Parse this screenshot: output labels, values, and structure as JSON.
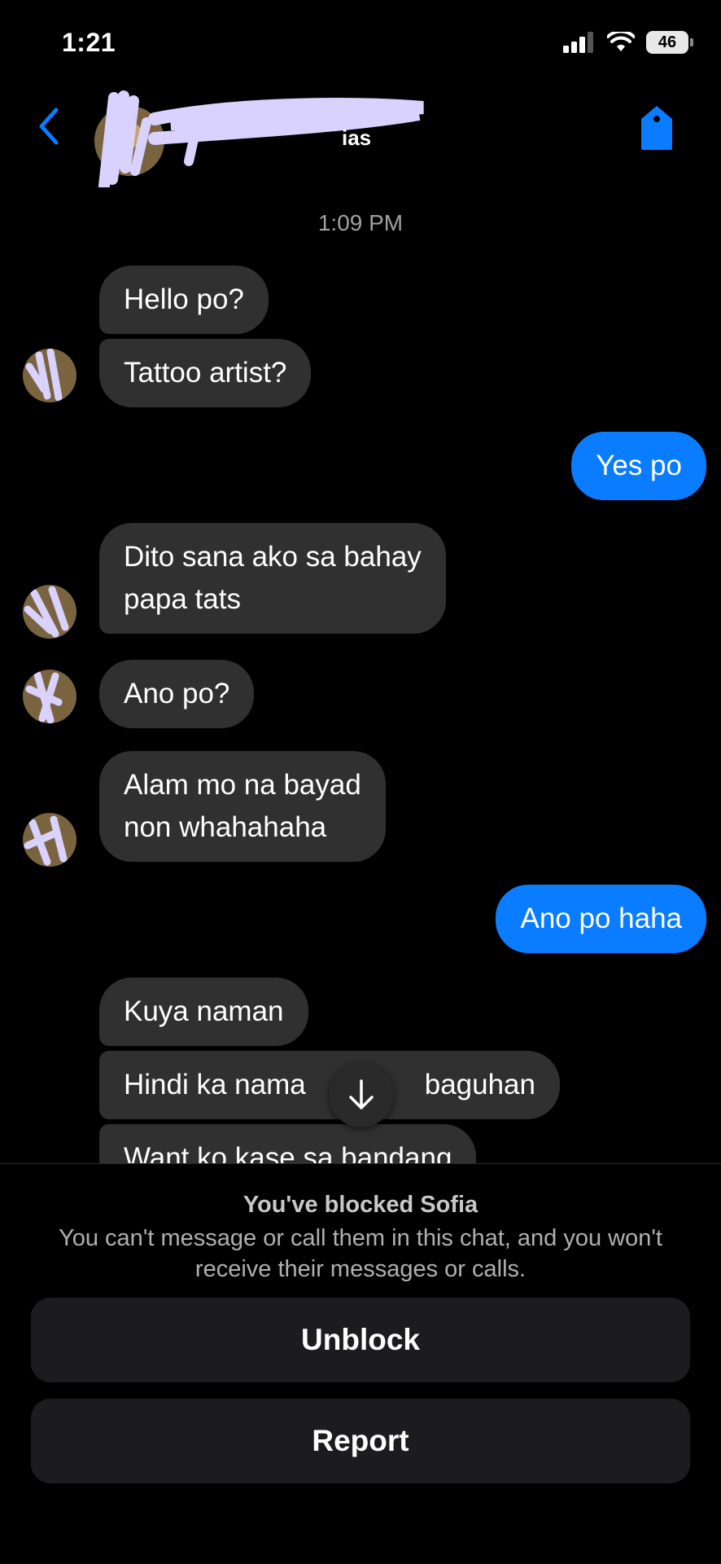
{
  "status_bar": {
    "time": "1:21",
    "battery": "46"
  },
  "header": {
    "contact_name": "redacted",
    "accent": "#0a7cff"
  },
  "chat": {
    "timestamp": "1:09 PM",
    "messages": [
      {
        "side": "in",
        "text": "Hello po?"
      },
      {
        "side": "in",
        "text": "Tattoo artist?"
      },
      {
        "side": "out",
        "text": "Yes po"
      },
      {
        "side": "in",
        "lines": [
          "Dito sana ako sa bahay",
          "papa tats"
        ]
      },
      {
        "side": "in",
        "text": "Ano po?"
      },
      {
        "side": "in",
        "lines": [
          "Alam mo na bayad",
          "non whahahaha"
        ]
      },
      {
        "side": "out",
        "text": "Ano po haha"
      },
      {
        "side": "in",
        "text": "Kuya naman"
      },
      {
        "side": "in",
        "text_left": "Hindi ka nama",
        "text_right": "baguhan"
      },
      {
        "side": "in",
        "text": "Want ko kase sa bandang"
      }
    ]
  },
  "blocked": {
    "title": "You've blocked Sofia",
    "description": "You can't message or call them in this chat, and you won't receive their messages or calls.",
    "unblock_label": "Unblock",
    "report_label": "Report"
  },
  "colors": {
    "incoming_bubble": "#303030",
    "outgoing_bubble": "#0a7cff",
    "scribble": "#d9d2ff"
  }
}
